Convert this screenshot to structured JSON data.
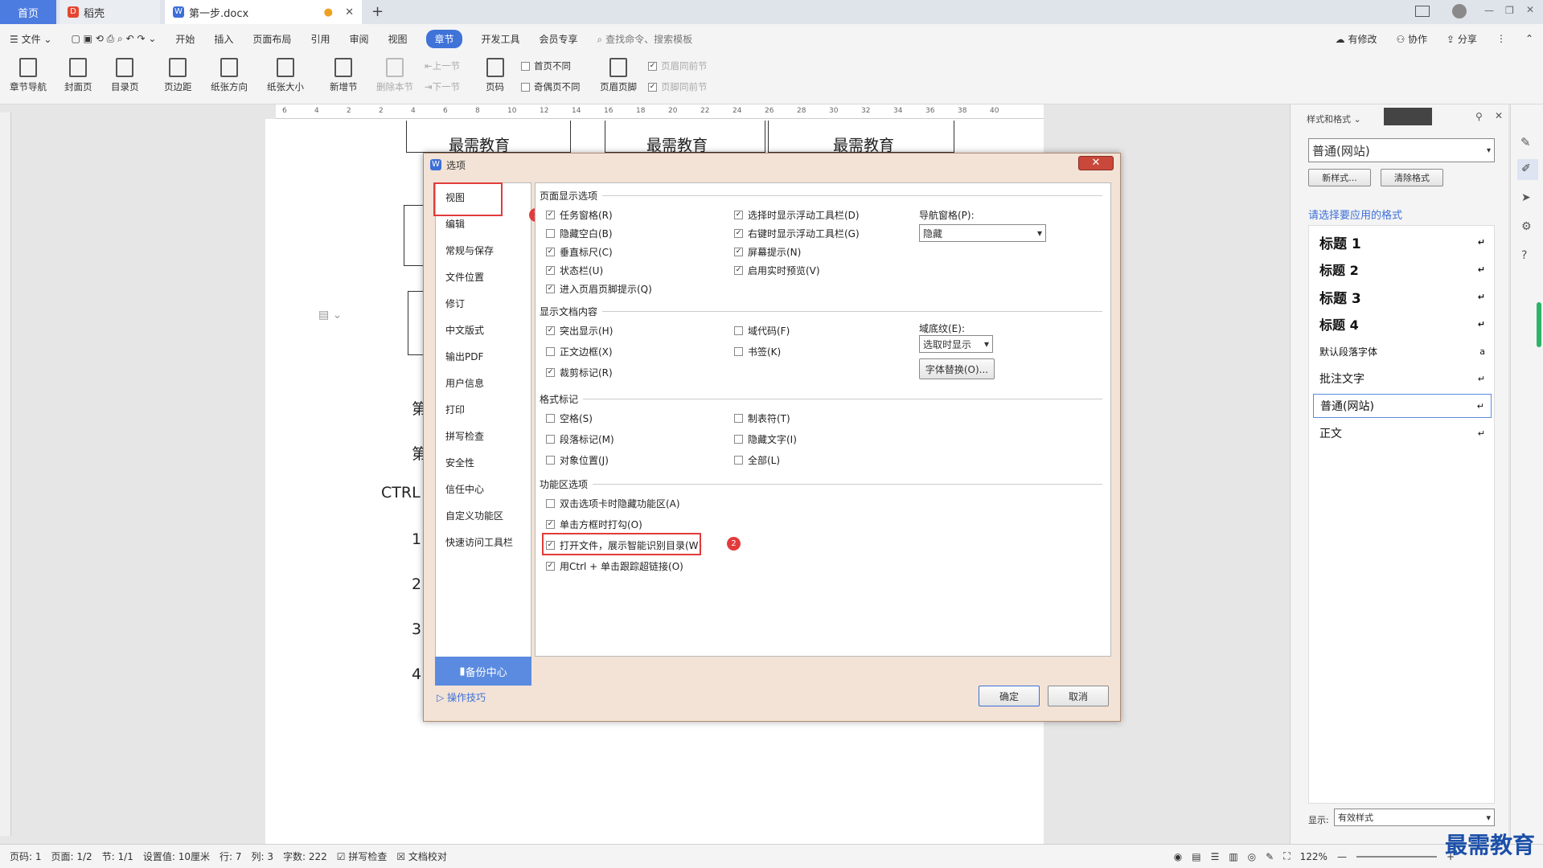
{
  "tabs": {
    "home": "首页",
    "t2": "稻壳",
    "doc": "第一步.docx"
  },
  "menu": {
    "file": "文件",
    "items": [
      "开始",
      "插入",
      "页面布局",
      "引用",
      "审阅",
      "视图",
      "章节",
      "开发工具",
      "会员专享"
    ],
    "search": "查找命令、搜索模板",
    "modify": "有修改",
    "collab": "协作",
    "share": "分享"
  },
  "ribbon": {
    "nav": "章节导航",
    "cover": "封面页",
    "toc": "目录页",
    "margin": "页边距",
    "orient": "纸张方向",
    "size": "纸张大小",
    "newsec": "新增节",
    "delsec": "删除本节",
    "prev": "上一节",
    "next": "下一节",
    "pageno": "页码",
    "firstdiff": "首页不同",
    "oddeven": "奇偶页不同",
    "hf": "页眉页脚",
    "hsame": "页眉同前节",
    "fsame": "页脚同前节"
  },
  "ruler": [
    "6",
    "4",
    "2",
    "2",
    "4",
    "6",
    "8",
    "10",
    "12",
    "14",
    "16",
    "18",
    "20",
    "22",
    "24",
    "26",
    "28",
    "30",
    "32",
    "34",
    "36",
    "38",
    "40"
  ],
  "doc": {
    "edu": "最需教育",
    "c1": "第",
    "c2": "第",
    "c3": "CTRL",
    "n1": "1",
    "n2": "2",
    "n3": "3",
    "n4": "4"
  },
  "dialog": {
    "title": "选项",
    "close": "✕",
    "nav": [
      "视图",
      "编辑",
      "常规与保存",
      "文件位置",
      "修订",
      "中文版式",
      "输出PDF",
      "用户信息",
      "打印",
      "拼写检查",
      "安全性",
      "信任中心",
      "自定义功能区",
      "快速访问工具栏"
    ],
    "backup": "备份中心",
    "tips": "操作技巧",
    "sec1": "页面显示选项",
    "sec2": "显示文档内容",
    "sec3": "格式标记",
    "sec4": "功能区选项",
    "o1": "任务窗格(R)",
    "o2": "隐藏空白(B)",
    "o3": "垂直标尺(C)",
    "o4": "状态栏(U)",
    "o5": "进入页眉页脚提示(Q)",
    "o6": "选择时显示浮动工具栏(D)",
    "o7": "右键时显示浮动工具栏(G)",
    "o8": "屏幕提示(N)",
    "o9": "启用实时预览(V)",
    "navlabel": "导航窗格(P):",
    "navval": "隐藏",
    "o10": "突出显示(H)",
    "o11": "正文边框(X)",
    "o12": "裁剪标记(R)",
    "o13": "域代码(F)",
    "o14": "书签(K)",
    "shadelabel": "域底纹(E):",
    "shadeval": "选取时显示",
    "fontrep": "字体替换(O)...",
    "o15": "空格(S)",
    "o16": "段落标记(M)",
    "o17": "对象位置(J)",
    "o18": "制表符(T)",
    "o19": "隐藏文字(I)",
    "o20": "全部(L)",
    "o21": "双击选项卡时隐藏功能区(A)",
    "o22": "单击方框时打勾(O)",
    "o23": "打开文件，展示智能识别目录(W)",
    "o24": "用Ctrl + 单击跟踪超链接(O)",
    "ok": "确定",
    "cancel": "取消",
    "b1": "1",
    "b2": "2"
  },
  "rpane": {
    "title": "样式和格式",
    "cur": "普通(网站)",
    "newstyle": "新样式...",
    "clear": "清除格式",
    "prompt": "请选择要应用的格式",
    "styles": [
      "标题 1",
      "标题 2",
      "标题 3",
      "标题 4",
      "默认段落字体",
      "批注文字",
      "普通(网站)",
      "正文"
    ],
    "showlabel": "显示:",
    "showval": "有效样式"
  },
  "status": {
    "pageno": "页码: 1",
    "page": "页面: 1/2",
    "sec": "节: 1/1",
    "setting": "设置值: 10厘米",
    "row": "行: 7",
    "col": "列: 3",
    "words": "字数: 222",
    "spell": "拼写检查",
    "proof": "文档校对",
    "zoom": "122%"
  },
  "watermark": "最需教育"
}
